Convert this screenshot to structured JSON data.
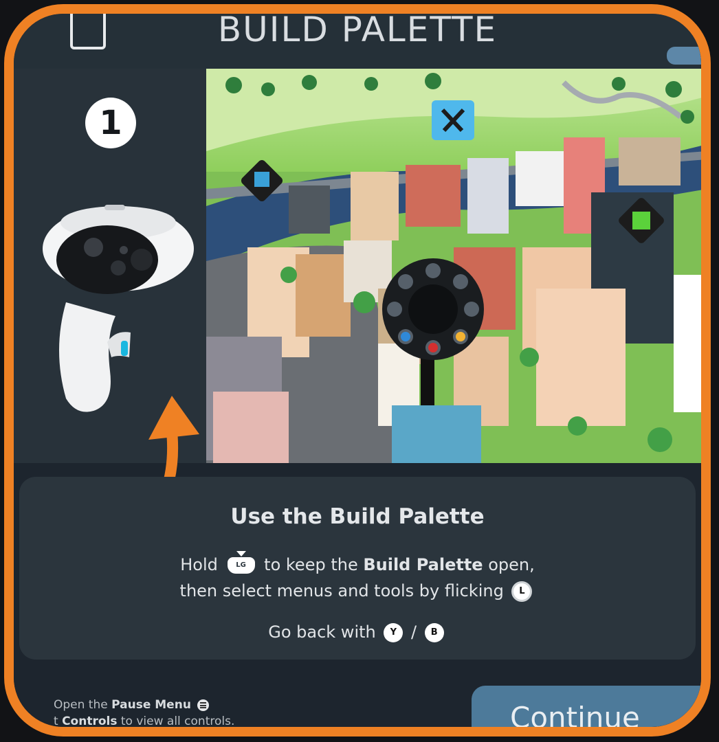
{
  "header": {
    "title": "BUILD PALETTE"
  },
  "step": {
    "number": "1"
  },
  "card": {
    "title": "Use the Build Palette",
    "line1_pre": "Hold",
    "line1_mid": "to keep the",
    "line1_bold": "Build Palette",
    "line1_post": "open,",
    "line2": "then select menus and tools by flicking",
    "line3": "Go back with",
    "line3_sep": "/",
    "trigger_label": "LG",
    "stick_label": "L",
    "btn_y": "Y",
    "btn_b": "B"
  },
  "footer": {
    "line1_pre": "Open the",
    "line1_bold": "Pause Menu",
    "line2_pre": "t",
    "line2_bold": "Controls",
    "line2_post": "to view all controls.",
    "continue_label": "Continue"
  },
  "colors": {
    "accent": "#ef8124",
    "panel": "#2b353d",
    "continue": "#4d7a9a"
  },
  "icons": [
    "controller-icon",
    "curved-arrow-icon",
    "tools-icon",
    "build-palette-radial-icon",
    "menu-icon"
  ]
}
